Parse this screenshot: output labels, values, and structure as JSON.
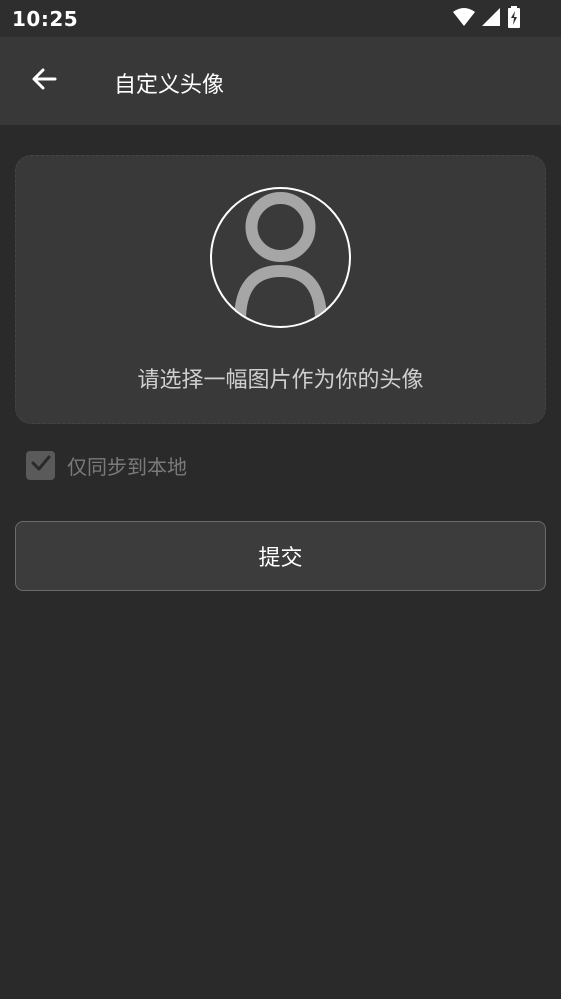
{
  "status_bar": {
    "time": "10:25",
    "icons": [
      "wifi-icon",
      "signal-icon",
      "battery-charging-icon"
    ]
  },
  "app_bar": {
    "back_icon": "arrow-back-icon",
    "title": "自定义头像"
  },
  "picker": {
    "avatar_icon": "person-placeholder-icon",
    "hint": "请选择一幅图片作为你的头像"
  },
  "sync_option": {
    "label": "仅同步到本地",
    "checked": true
  },
  "submit": {
    "label": "提交"
  },
  "colors": {
    "background": "#2a2a2a",
    "app_bar": "#383838",
    "card": "#393939",
    "text_primary": "#ffffff",
    "text_muted": "#7a7a7a"
  }
}
